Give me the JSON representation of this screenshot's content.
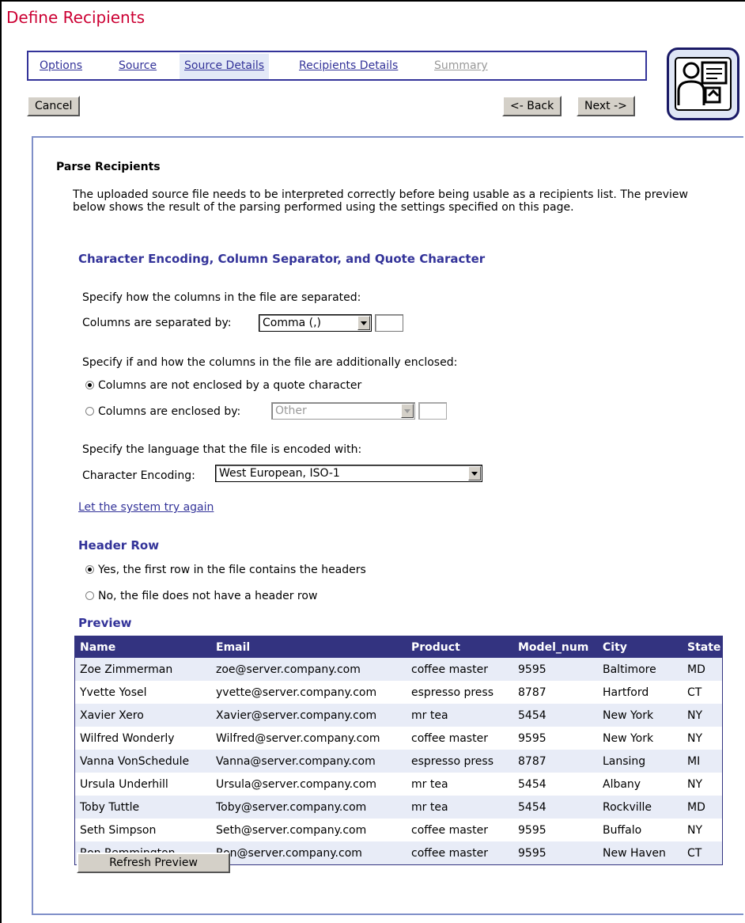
{
  "page_title": "Define Recipients",
  "tabs": [
    {
      "label": "Options",
      "state": "link"
    },
    {
      "label": "Source",
      "state": "link"
    },
    {
      "label": "Source Details",
      "state": "active"
    },
    {
      "label": "Recipients Details",
      "state": "link"
    },
    {
      "label": "Summary",
      "state": "disabled"
    }
  ],
  "nav": {
    "cancel": "Cancel",
    "back": "<- Back",
    "next": "Next ->"
  },
  "parse": {
    "heading": "Parse Recipients",
    "description": "The uploaded source file needs to be interpreted correctly before being usable as a recipients list. The preview below shows the result of the parsing performed using the settings specified on this page."
  },
  "encoding_section": {
    "title": "Character Encoding, Column Separator, and Quote Character",
    "separator_prompt": "Specify how the columns in the file are separated:",
    "separator_label": "Columns are separated by:",
    "separator_value": "Comma (,)",
    "enclosure_prompt": "Specify if and how the columns in the file are additionally enclosed:",
    "not_enclosed_label": "Columns are not enclosed by a quote character",
    "enclosed_label": "Columns are enclosed by:",
    "enclosed_value": "Other",
    "language_prompt": "Specify the language that the file is encoded with:",
    "encoding_label": "Character Encoding:",
    "encoding_value": "West European, ISO-1",
    "retry_link": "Let the system try again"
  },
  "header_section": {
    "title": "Header Row",
    "yes_label": "Yes, the first row in the file contains the headers",
    "no_label": "No, the file does not have a header row"
  },
  "preview": {
    "title": "Preview",
    "columns": [
      "Name",
      "Email",
      "Product",
      "Model_num",
      "City",
      "State"
    ],
    "rows": [
      [
        "Zoe Zimmerman",
        "zoe@server.company.com",
        "coffee master",
        "9595",
        "Baltimore",
        "MD"
      ],
      [
        "Yvette Yosel",
        "yvette@server.company.com",
        "espresso press",
        "8787",
        "Hartford",
        "CT"
      ],
      [
        "Xavier Xero",
        "Xavier@server.company.com",
        "mr tea",
        "5454",
        "New York",
        "NY"
      ],
      [
        "Wilfred Wonderly",
        "Wilfred@server.company.com",
        "coffee master",
        "9595",
        "New York",
        "NY"
      ],
      [
        "Vanna VonSchedule",
        "Vanna@server.company.com",
        "espresso press",
        "8787",
        "Lansing",
        "MI"
      ],
      [
        "Ursula Underhill",
        "Ursula@server.company.com",
        "mr tea",
        "5454",
        "Albany",
        "NY"
      ],
      [
        "Toby Tuttle",
        "Toby@server.company.com",
        "mr tea",
        "5454",
        "Rockville",
        "MD"
      ],
      [
        "Seth Simpson",
        "Seth@server.company.com",
        "coffee master",
        "9595",
        "Buffalo",
        "NY"
      ],
      [
        "Ron Remmington",
        "Ron@server.company.com",
        "coffee master",
        "9595",
        "New Haven",
        "CT"
      ]
    ],
    "refresh_button": "Refresh Preview"
  },
  "icons": {
    "logo": "recipients-wizard-icon"
  }
}
